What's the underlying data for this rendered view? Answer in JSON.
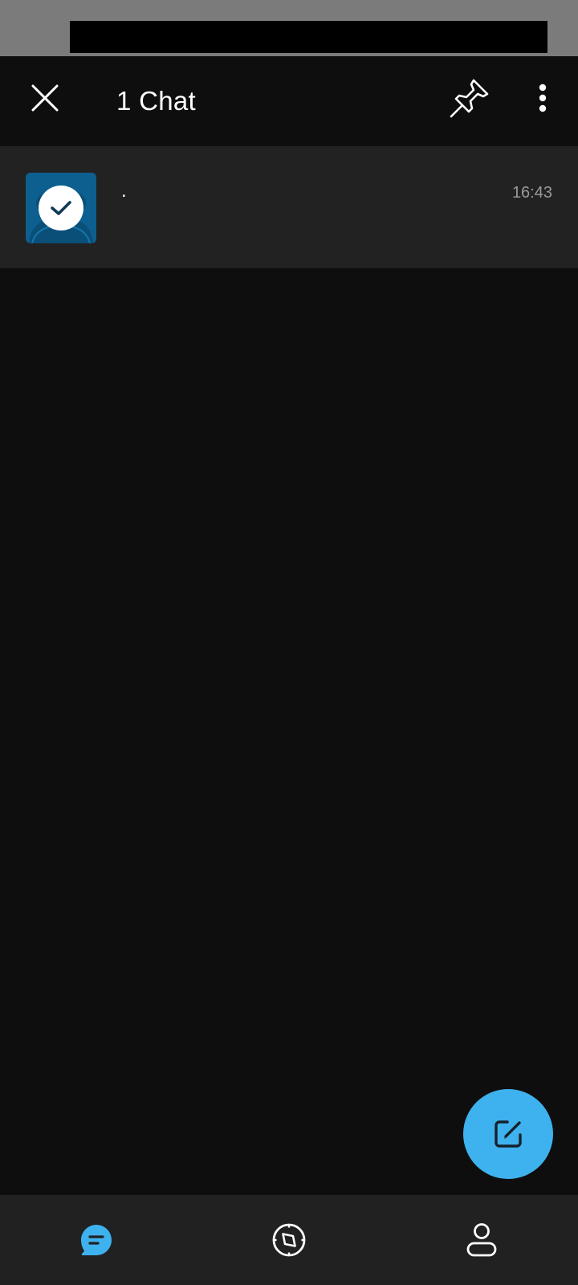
{
  "colors": {
    "accent": "#3eb2ee",
    "background": "#0e0e0e",
    "surface": "#222222",
    "status_bar": "#7b7b7b",
    "avatar": "#0d5f8f",
    "muted_text": "#9a9a9a"
  },
  "app_bar": {
    "title": "1 Chat",
    "close_icon": "close-icon",
    "pin_icon": "pin-icon",
    "more_icon": "more-vertical-icon"
  },
  "chat_list": {
    "items": [
      {
        "name": ".",
        "time": "16:43",
        "selected": true,
        "avatar_icon": "checkmark-icon"
      }
    ]
  },
  "fab": {
    "icon": "compose-icon"
  },
  "bottom_nav": {
    "items": [
      {
        "id": "chats",
        "icon": "chat-bubble-icon",
        "active": true
      },
      {
        "id": "discover",
        "icon": "compass-icon",
        "active": false
      },
      {
        "id": "profile",
        "icon": "person-icon",
        "active": false
      }
    ]
  }
}
